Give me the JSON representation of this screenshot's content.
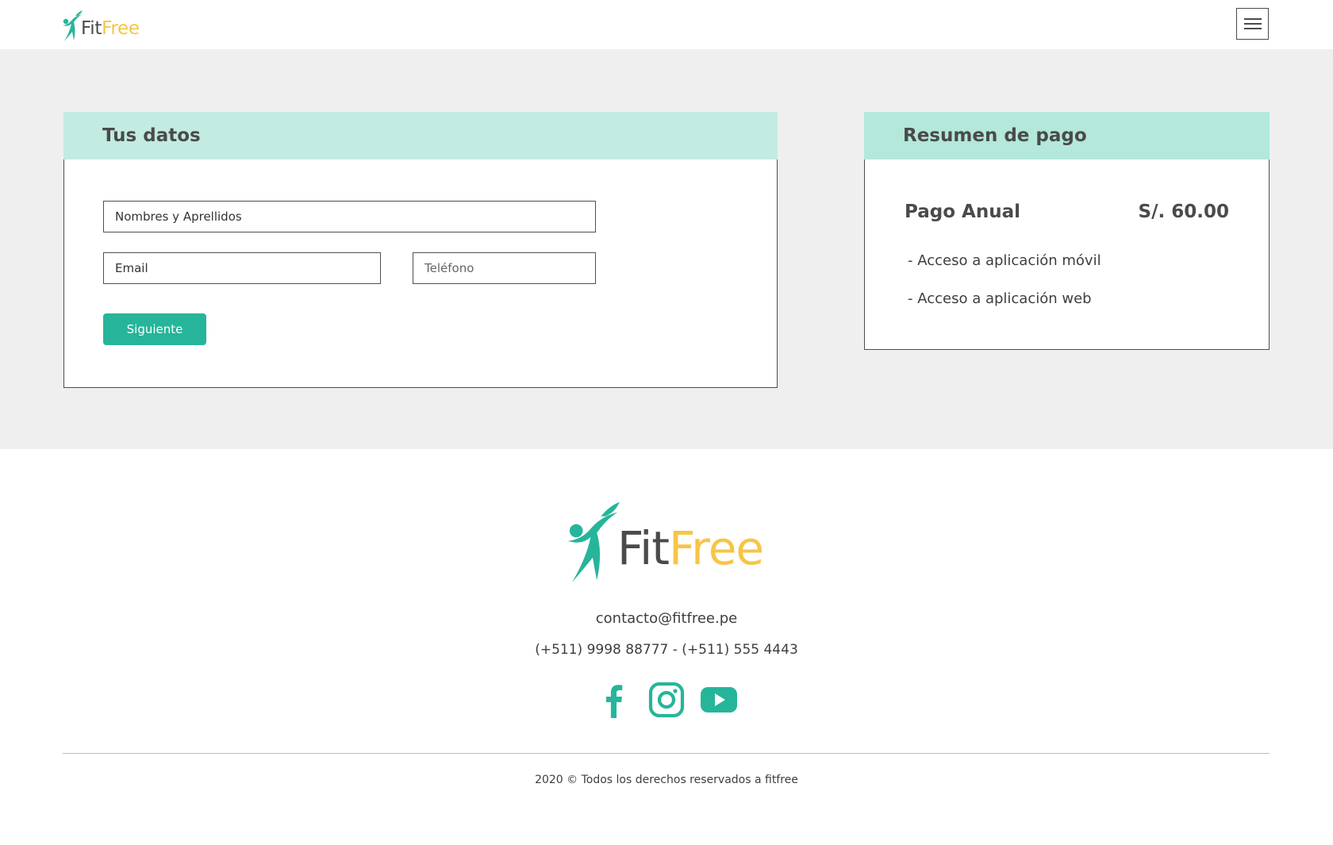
{
  "brand": {
    "logo_fit": "Fit",
    "logo_free": "Free",
    "primary_color": "#26b59a",
    "accent_color": "#f7c545"
  },
  "header": {
    "menu_icon": "hamburger-menu-icon"
  },
  "datos": {
    "title": "Tus datos",
    "nombre_placeholder": "Nombres y Aprellidos",
    "email_placeholder": "Email",
    "telefono_placeholder": "Teléfono",
    "submit_label": "Siguiente"
  },
  "resumen": {
    "title": "Resumen de pago",
    "plan_label": "Pago Anual",
    "plan_price": "S/. 60.00",
    "features": [
      "- Acceso a aplicación móvil",
      "- Acceso a aplicación web"
    ]
  },
  "footer": {
    "email": "contacto@fitfree.pe",
    "phones": "(+511) 9998 88777 - (+511) 555 4443",
    "social_icons": [
      "facebook-icon",
      "instagram-icon",
      "youtube-icon"
    ],
    "copyright": "2020 © Todos los derechos reservados a fitfree"
  }
}
